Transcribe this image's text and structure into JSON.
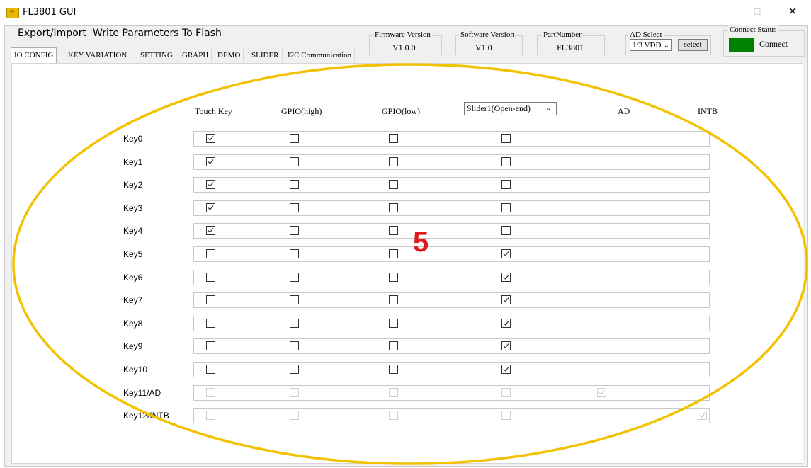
{
  "window": {
    "title": "FL3801 GUI",
    "icon": "app-logo-icon",
    "icon_text": "FL"
  },
  "menu": [
    "Export/Import",
    "Write Parameters To Flash"
  ],
  "tabs": [
    "IO CONFIG",
    "KEY VARIATION",
    "SETTING",
    "GRAPH",
    "DEMO",
    "SLIDER",
    "I2C Communication"
  ],
  "active_tab": "IO CONFIG",
  "firmware": {
    "title": "Firmware Version",
    "value": "V1.0.0"
  },
  "software": {
    "title": "Software Version",
    "value": "V1.0"
  },
  "part": {
    "title": "PartNumber",
    "value": "FL3801"
  },
  "ad_select": {
    "title": "AD Select",
    "value": "1/3 VDD",
    "button": "select"
  },
  "connect": {
    "title": "Connect Status",
    "value": "Connect",
    "led_color": "#008000"
  },
  "columns": {
    "touch": "Touch Key",
    "gpio_high": "GPIO(high)",
    "gpio_low": "GPIO(low)",
    "slider": "Slider1(Open-end)",
    "ad": "AD",
    "intb": "INTB"
  },
  "rows": [
    {
      "label": "Key0",
      "touch": true,
      "gpio_high": false,
      "gpio_low": false,
      "slider": false,
      "disabled": false
    },
    {
      "label": "Key1",
      "touch": true,
      "gpio_high": false,
      "gpio_low": false,
      "slider": false,
      "disabled": false
    },
    {
      "label": "Key2",
      "touch": true,
      "gpio_high": false,
      "gpio_low": false,
      "slider": false,
      "disabled": false
    },
    {
      "label": "Key3",
      "touch": true,
      "gpio_high": false,
      "gpio_low": false,
      "slider": false,
      "disabled": false
    },
    {
      "label": "Key4",
      "touch": true,
      "gpio_high": false,
      "gpio_low": false,
      "slider": false,
      "disabled": false
    },
    {
      "label": "Key5",
      "touch": false,
      "gpio_high": false,
      "gpio_low": false,
      "slider": true,
      "disabled": false
    },
    {
      "label": "Key6",
      "touch": false,
      "gpio_high": false,
      "gpio_low": false,
      "slider": true,
      "disabled": false
    },
    {
      "label": "Key7",
      "touch": false,
      "gpio_high": false,
      "gpio_low": false,
      "slider": true,
      "disabled": false
    },
    {
      "label": "Key8",
      "touch": false,
      "gpio_high": false,
      "gpio_low": false,
      "slider": true,
      "disabled": false
    },
    {
      "label": "Key9",
      "touch": false,
      "gpio_high": false,
      "gpio_low": false,
      "slider": true,
      "disabled": false
    },
    {
      "label": "Key10",
      "touch": false,
      "gpio_high": false,
      "gpio_low": false,
      "slider": true,
      "disabled": false
    },
    {
      "label": "Key11/AD",
      "touch": false,
      "gpio_high": false,
      "gpio_low": false,
      "slider": false,
      "ad": true,
      "disabled": true
    },
    {
      "label": "Key12/INTB",
      "touch": false,
      "gpio_high": false,
      "gpio_low": false,
      "slider": false,
      "intb": true,
      "disabled": true
    }
  ],
  "annotation": {
    "label": "5",
    "ellipse_color": "#f2c200",
    "label_color": "#e0191b"
  }
}
